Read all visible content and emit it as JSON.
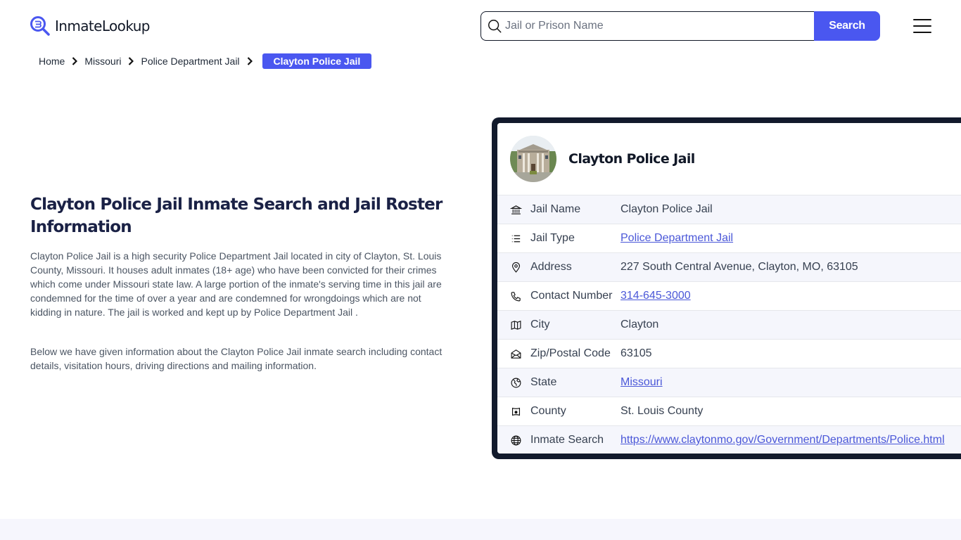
{
  "header": {
    "logo_text": "InmateLookup",
    "search_placeholder": "Jail or Prison Name",
    "search_value": "",
    "search_button": "Search",
    "accent_color": "#4a57f0"
  },
  "breadcrumb": [
    {
      "label": "Home"
    },
    {
      "label": "Missouri"
    },
    {
      "label": "Police Department Jail"
    },
    {
      "label": "Clayton Police Jail",
      "current": true
    }
  ],
  "main": {
    "title": "Clayton Police Jail Inmate Search and Jail Roster Information",
    "paragraphs": [
      "Clayton Police Jail is a high security Police Department Jail located in city of Clayton, St. Louis County, Missouri. It houses adult inmates (18+ age) who have been convicted for their crimes which come under Missouri state law. A large portion of the inmate's serving time in this jail are condemned for the time of over a year and are condemned for wrongdoings which are not kidding in nature. The jail is worked and kept up by Police Department Jail .",
      "Below we have given information about the Clayton Police Jail inmate search including contact details, visitation hours, driving directions and mailing information."
    ]
  },
  "card": {
    "title": "Clayton Police Jail",
    "rows": [
      {
        "icon": "bank-icon",
        "label": "Jail Name",
        "value": "Clayton Police Jail",
        "link": false
      },
      {
        "icon": "list-icon",
        "label": "Jail Type",
        "value": "Police Department Jail",
        "link": true
      },
      {
        "icon": "map-pin-icon",
        "label": "Address",
        "value": "227 South Central Avenue, Clayton, MO, 63105",
        "link": false
      },
      {
        "icon": "phone-icon",
        "label": "Contact Number",
        "value": "314-645-3000",
        "link": true
      },
      {
        "icon": "map-icon",
        "label": "City",
        "value": "Clayton",
        "link": false
      },
      {
        "icon": "mail-open-icon",
        "label": "Zip/Postal Code",
        "value": "63105",
        "link": false
      },
      {
        "icon": "globe-location-icon",
        "label": "State",
        "value": "Missouri",
        "link": true
      },
      {
        "icon": "county-map-icon",
        "label": "County",
        "value": "St. Louis County",
        "link": false
      },
      {
        "icon": "globe-icon",
        "label": "Inmate Search",
        "value": "https://www.claytonmo.gov/Government/Departments/Police.html",
        "link": true
      }
    ]
  }
}
